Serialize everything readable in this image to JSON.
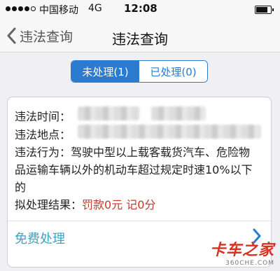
{
  "status_bar": {
    "carrier": "中国移动",
    "network": "4G",
    "time": "12:08"
  },
  "nav": {
    "back_label": "违法查询",
    "title": "违法查询"
  },
  "tabs": [
    {
      "label": "未处理(1)",
      "active": true
    },
    {
      "label": "已处理(0)",
      "active": false
    }
  ],
  "violation": {
    "time_label": "违法时间：",
    "place_label": "违法地点：",
    "behavior_label": "违法行为：",
    "behavior_text": "驾驶中型以上载客载货汽车、危险物品运输车辆以外的机动车超过规定时速10%以下的",
    "result_label": "拟处理结果：",
    "result_value": "罚款0元 记0分"
  },
  "action": {
    "label": "免费处理",
    "chevron": "❯"
  },
  "watermark": {
    "main": "卡车之家",
    "sub": "360CHE.COM"
  },
  "colors": {
    "accent": "#2b7bd1",
    "fine": "#c0392b",
    "action": "#3aa3c6"
  }
}
